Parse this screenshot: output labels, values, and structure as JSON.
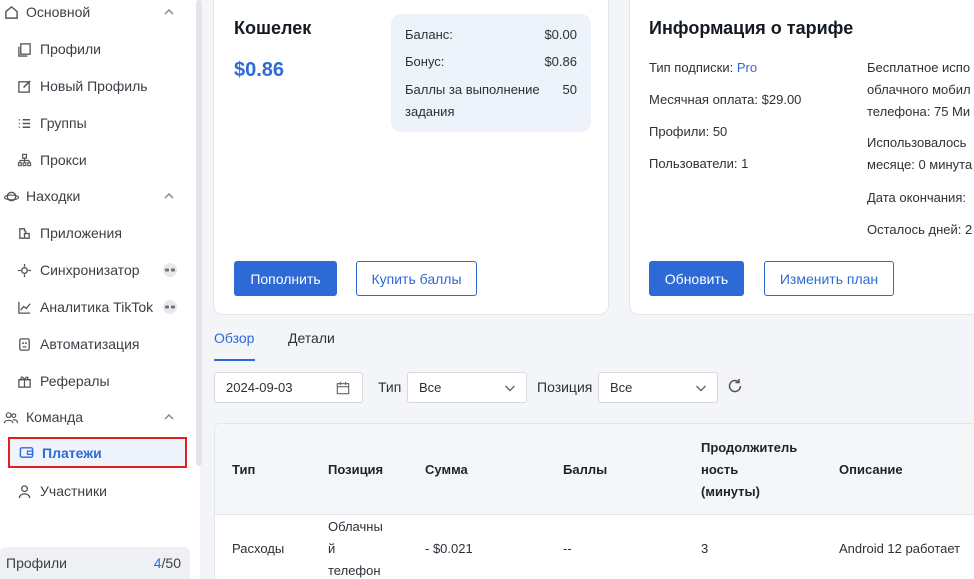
{
  "sidebar": {
    "groups": [
      {
        "label": "Основной",
        "icon": "home-icon"
      },
      {
        "label": "Находки",
        "icon": "planet-icon"
      },
      {
        "label": "Команда",
        "icon": "team-icon"
      }
    ],
    "items": [
      {
        "label": "Профили",
        "icon": "profiles-icon"
      },
      {
        "label": "Новый Профиль",
        "icon": "edit-icon"
      },
      {
        "label": "Группы",
        "icon": "list-icon"
      },
      {
        "label": "Прокси",
        "icon": "network-icon"
      },
      {
        "label": "Приложения",
        "icon": "puzzle-icon"
      },
      {
        "label": "Синхронизатор",
        "icon": "sync-icon"
      },
      {
        "label": "Аналитика TikTok",
        "icon": "chart-icon"
      },
      {
        "label": "Автоматизация",
        "icon": "robot-icon"
      },
      {
        "label": "Рефералы",
        "icon": "gift-icon"
      },
      {
        "label": "Платежи",
        "icon": "wallet-icon",
        "active": true
      },
      {
        "label": "Участники",
        "icon": "user-icon"
      }
    ],
    "footer": {
      "label": "Профили",
      "used": "4",
      "total": "/50"
    }
  },
  "wallet": {
    "title": "Кошелек",
    "amount": "$0.86",
    "balance_label": "Баланс:",
    "balance_value": "$0.00",
    "bonus_label": "Бонус:",
    "bonus_value": "$0.86",
    "points_label": "Баллы за выполнение задания",
    "points_value": "50",
    "topup_button": "Пополнить",
    "buy_points_button": "Купить баллы"
  },
  "tariff": {
    "title": "Информация о тарифе",
    "subscription_label": "Тип подписки:",
    "subscription_value": "Pro",
    "monthly": "Месячная оплата: $29.00",
    "profiles": "Профили: 50",
    "users": "Пользователи: 1",
    "free_cloud_line1": "Бесплатное испо",
    "free_cloud_line2": "облачного мобил",
    "free_cloud_line3": "телефона: 75 Ми",
    "used_line1": "Использовалось",
    "used_line2": "месяце: 0 минута",
    "end_date": "Дата окончания:",
    "days_left": "Осталось дней: 2",
    "update_button": "Обновить",
    "change_plan_button": "Изменить план"
  },
  "tabs": [
    {
      "label": "Обзор",
      "active": true
    },
    {
      "label": "Детали",
      "active": false
    }
  ],
  "filters": {
    "date": "2024-09-03",
    "type_label": "Тип",
    "type_value": "Все",
    "position_label": "Позиция",
    "position_value": "Все"
  },
  "table": {
    "headers": [
      "Тип",
      "Позиция",
      "Сумма",
      "Баллы",
      "Продолжитель ность (минуты)",
      "Описание"
    ],
    "header_duration_lines": [
      "Продолжитель",
      "ность",
      "(минуты)"
    ],
    "rows": [
      {
        "type": "Расходы",
        "position_lines": [
          "Облачны",
          "й",
          "телефон"
        ],
        "amount": "- $0.021",
        "points": "--",
        "duration": "3",
        "description": "Android 12 работает"
      }
    ]
  },
  "colors": {
    "accent": "#2d6ad6",
    "highlight_border": "#e02020"
  }
}
